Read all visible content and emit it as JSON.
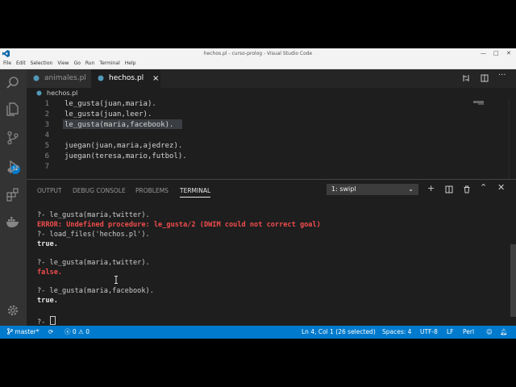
{
  "window": {
    "title": "hechos.pl - curso-prolog - Visual Studio Code"
  },
  "menu": [
    "File",
    "Edit",
    "Selection",
    "View",
    "Go",
    "Run",
    "Terminal",
    "Help"
  ],
  "tabs": [
    {
      "label": "animales.pl"
    },
    {
      "label": "hechos.pl",
      "close": "×"
    }
  ],
  "breadcrumb": {
    "file": "hechos.pl"
  },
  "editor": {
    "lines": [
      {
        "n": "1",
        "text": "le_gusta(juan,maria)."
      },
      {
        "n": "2",
        "text": "le_gusta(juan,leer)."
      },
      {
        "n": "3",
        "text": "le_gusta(maria,facebook)."
      },
      {
        "n": "4",
        "text": ""
      },
      {
        "n": "5",
        "text": "juegan(juan,maria,ajedrez)."
      },
      {
        "n": "6",
        "text": "juegan(teresa,mario,futbol)."
      },
      {
        "n": "7",
        "text": ""
      }
    ]
  },
  "activity": {
    "scm_badge": "12"
  },
  "panel": {
    "tabs": [
      "OUTPUT",
      "DEBUG CONSOLE",
      "PROBLEMS",
      "TERMINAL"
    ],
    "terminal_select": "1: swipl",
    "lines": [
      {
        "text": "?- le_gusta(maria,twitter).",
        "style": "prompt"
      },
      {
        "text": "ERROR: Undefined procedure: le_gusta/2 (DWIM could not correct goal)",
        "style": "error"
      },
      {
        "text": "?- load_files('hechos.pl').",
        "style": "prompt"
      },
      {
        "text": "true.",
        "style": "bold"
      },
      {
        "text": "?- le_gusta(maria,twitter).",
        "style": "prompt"
      },
      {
        "text": "false.",
        "style": "fail"
      },
      {
        "text": "?- le_gusta(maria,facebook).",
        "style": "prompt"
      },
      {
        "text": "true.",
        "style": "bold"
      },
      {
        "text": "?- ",
        "style": "prompt"
      }
    ]
  },
  "status": {
    "branch": "master*",
    "errors": "0",
    "warnings": "0",
    "position": "Ln 4, Col 1 (26 selected)",
    "spaces": "Spaces: 4",
    "encoding": "UTF-8",
    "eol": "LF",
    "language": "Perl"
  },
  "colors": {
    "accent": "#007acc",
    "error": "#f14c4c",
    "editor_bg": "#1e1e1e"
  }
}
